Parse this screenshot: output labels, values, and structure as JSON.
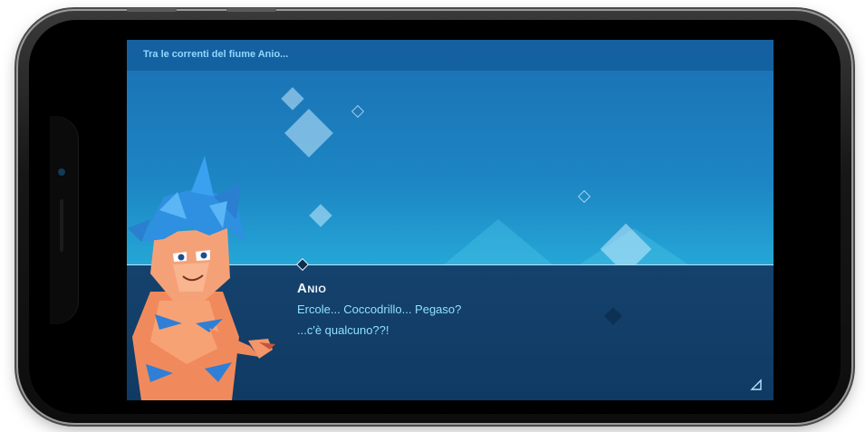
{
  "scene": {
    "title": "Tra le correnti del fiume Anio..."
  },
  "dialogue": {
    "speaker": "Anio",
    "lines": [
      "Ercole... Coccodrillo... Pegaso?",
      "...c'è qualcuno??!"
    ]
  },
  "icons": {
    "advance": "advance-triangle-icon",
    "character": "anio-character-portrait"
  },
  "colors": {
    "sky_top": "#1a6fb2",
    "sky_bottom": "#2cb1dc",
    "panel": "#15426d",
    "speaker_text": "#f2f7fb",
    "line_text": "#8fe0ff",
    "title_text": "#8fd8ff"
  }
}
